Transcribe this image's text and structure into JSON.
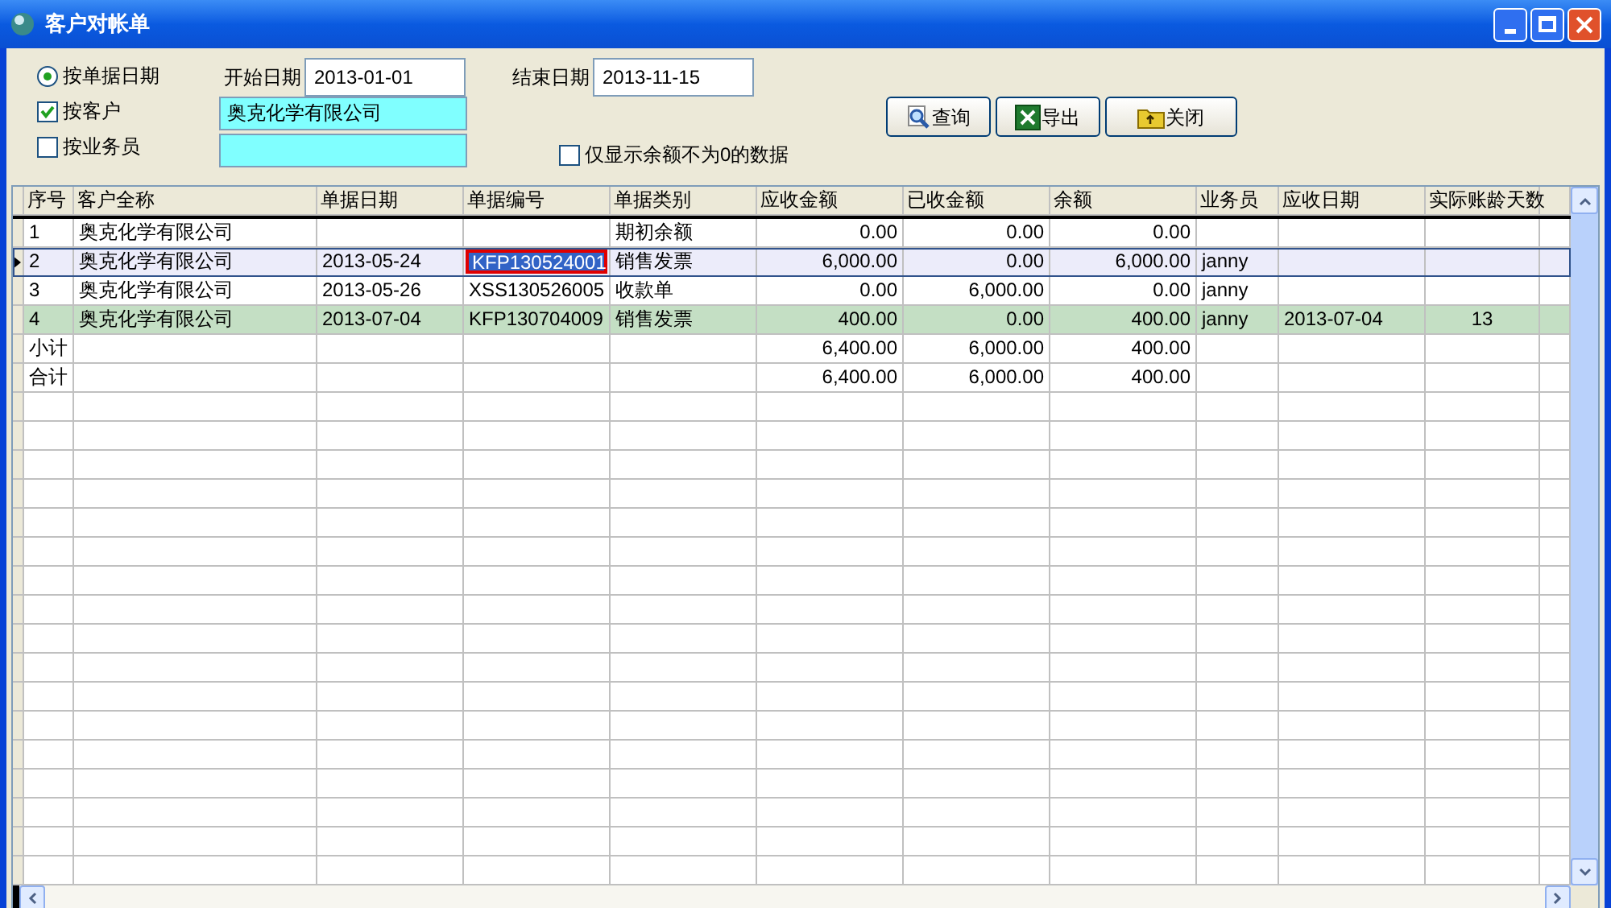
{
  "window": {
    "title": "客户对帐单"
  },
  "filters": {
    "date_mode": {
      "label": "按单据日期",
      "selected": true
    },
    "start_date": {
      "label": "开始日期",
      "value": "2013-01-01"
    },
    "end_date": {
      "label": "结束日期",
      "value": "2013-11-15"
    },
    "by_customer": {
      "label": "按客户",
      "checked": true,
      "value": "奥克化学有限公司"
    },
    "by_salesperson": {
      "label": "按业务员",
      "checked": false
    },
    "nonzero_only": {
      "label": "仅显示余额不为0的数据",
      "checked": false
    }
  },
  "buttons": [
    {
      "label": "查询"
    },
    {
      "label": "导出"
    },
    {
      "label": "关闭"
    }
  ],
  "table": {
    "columns": [
      {
        "label": "序号",
        "kind": "text"
      },
      {
        "label": "客户全称",
        "kind": "text"
      },
      {
        "label": "单据日期",
        "kind": "text"
      },
      {
        "label": "单据编号",
        "kind": "text"
      },
      {
        "label": "单据类别",
        "kind": "text"
      },
      {
        "label": "应收金额",
        "kind": "money"
      },
      {
        "label": "已收金额",
        "kind": "money"
      },
      {
        "label": "余额",
        "kind": "money"
      },
      {
        "label": "业务员",
        "kind": "text"
      },
      {
        "label": "应收日期",
        "kind": "text"
      },
      {
        "label": "实际账龄天数",
        "kind": "number"
      }
    ],
    "rows": [
      {
        "selected": false,
        "highlighted": false,
        "editing": false,
        "cells": [
          "1",
          "奥克化学有限公司",
          null,
          null,
          "期初余额",
          "0.00",
          "0.00",
          "0.00",
          null,
          null,
          null
        ]
      },
      {
        "selected": true,
        "highlighted": false,
        "editing": true,
        "cells": [
          "2",
          "奥克化学有限公司",
          "2013-05-24",
          "KFP130524001",
          "销售发票",
          "6,000.00",
          "0.00",
          "6,000.00",
          "janny",
          null,
          null
        ]
      },
      {
        "selected": false,
        "highlighted": false,
        "editing": false,
        "cells": [
          "3",
          "奥克化学有限公司",
          "2013-05-26",
          "XSS130526005",
          "收款单",
          "0.00",
          "6,000.00",
          "0.00",
          "janny",
          null,
          null
        ]
      },
      {
        "selected": false,
        "highlighted": true,
        "editing": false,
        "cells": [
          "4",
          "奥克化学有限公司",
          "2013-07-04",
          "KFP130704009",
          "销售发票",
          "400.00",
          "0.00",
          "400.00",
          "janny",
          "2013-07-04",
          "13"
        ]
      },
      {
        "selected": false,
        "highlighted": false,
        "editing": false,
        "cells": [
          "小计",
          null,
          null,
          null,
          null,
          "6,400.00",
          "6,000.00",
          "400.00",
          null,
          null,
          null
        ]
      },
      {
        "selected": false,
        "highlighted": false,
        "editing": false,
        "cells": [
          "合计",
          null,
          null,
          null,
          null,
          "6,400.00",
          "6,000.00",
          "400.00",
          null,
          null,
          null
        ]
      }
    ]
  }
}
